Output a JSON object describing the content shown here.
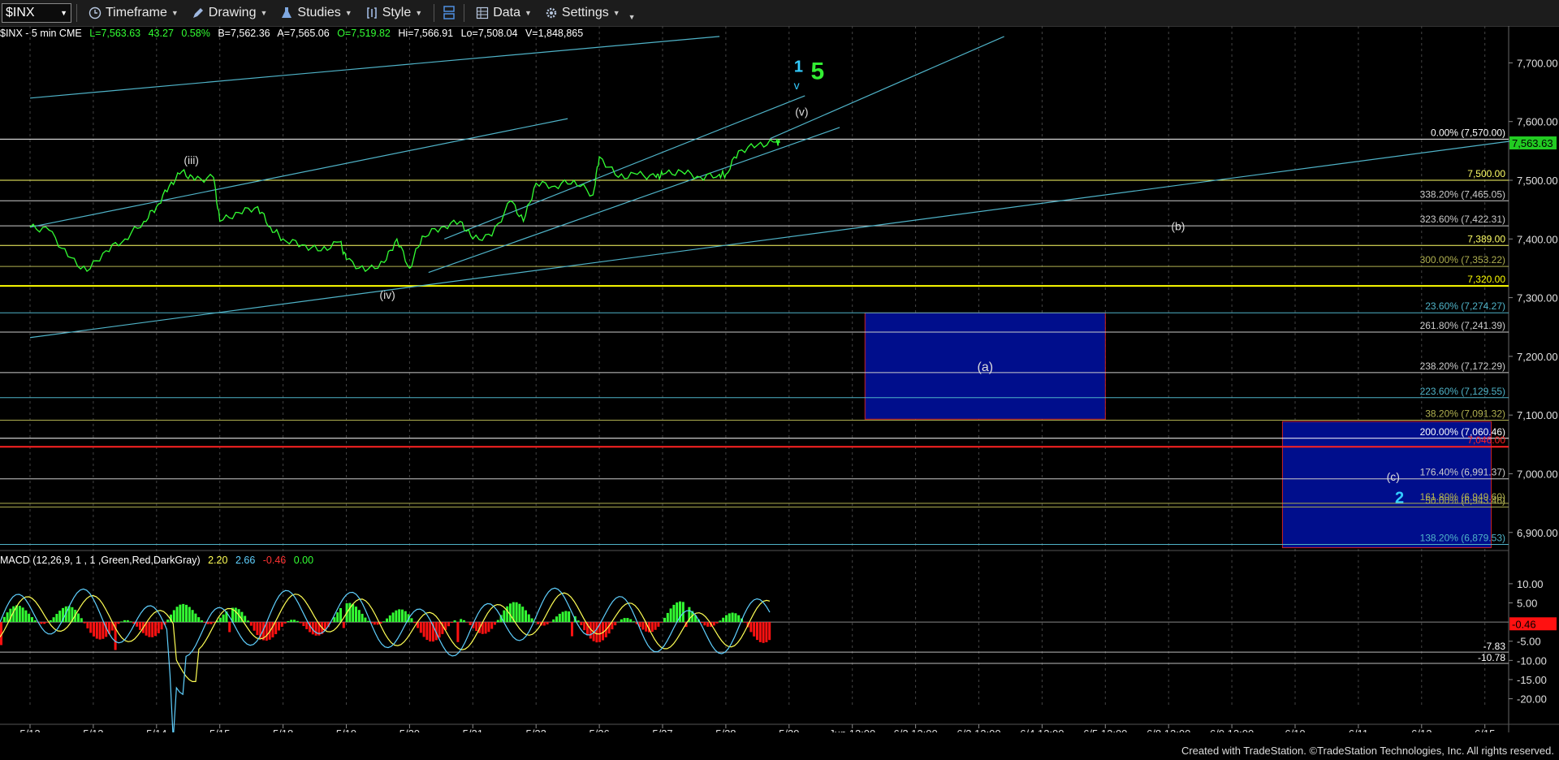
{
  "toolbar": {
    "symbol": "$INX",
    "items": [
      {
        "label": "Timeframe",
        "icon": "clock-icon"
      },
      {
        "label": "Drawing",
        "icon": "pencil-icon"
      },
      {
        "label": "Studies",
        "icon": "flask-icon"
      },
      {
        "label": "Style",
        "icon": "brackets-icon"
      },
      {
        "label": "Data",
        "icon": "grid-icon"
      },
      {
        "label": "Settings",
        "icon": "gear-icon"
      }
    ]
  },
  "info": {
    "symbol": "$INX - 5 min  CME",
    "last": "L=7,563.63",
    "chg": "43.27",
    "pct": "0.58%",
    "bid": "B=7,562.36",
    "ask": "A=7,565.06",
    "open": "O=7,519.82",
    "hi": "Hi=7,566.91",
    "lo": "Lo=7,508.04",
    "vol": "V=1,848,865"
  },
  "macd": {
    "label": "MACD (12,26,9, 1 , 1 ,Green,Red,DarkGray)",
    "v1": "2.20",
    "v2": "2.66",
    "v3": "-0.46",
    "v4": "0.00"
  },
  "footer": "Created with TradeStation. ©TradeStation Technologies, Inc. All rights reserved.",
  "colors": {
    "price": "#33ff33",
    "channel": "#4fb3c8",
    "box": "#000e8c",
    "macd_pos": "#33ff33",
    "macd_neg": "#ff1111"
  },
  "chart_data": {
    "type": "line",
    "title": "$INX - 5 min",
    "x_ticks": [
      "5/12",
      "5/13",
      "5/14",
      "5/15",
      "5/18",
      "5/19",
      "5/20",
      "5/21",
      "5/22",
      "5/26",
      "5/27",
      "5/28",
      "5/29",
      "Jun 12:00",
      "6/2 12:00",
      "6/3 12:00",
      "6/4 12:00",
      "6/5 12:00",
      "6/8 12:00",
      "6/9 12:00",
      "6/10",
      "6/11",
      "6/12",
      "6/15"
    ],
    "y_ticks": [
      "7,700.00",
      "7,600.00",
      "7,500.00",
      "7,400.00",
      "7,300.00",
      "7,200.00",
      "7,100.00",
      "7,000.00",
      "6,900.00"
    ],
    "ylim": [
      6872,
      7749
    ],
    "last_price": "7,563.63",
    "price_series": [
      {
        "x": 0.0,
        "y": 7420
      },
      {
        "x": 0.3,
        "y": 7415
      },
      {
        "x": 0.6,
        "y": 7370
      },
      {
        "x": 0.9,
        "y": 7345
      },
      {
        "x": 1.2,
        "y": 7380
      },
      {
        "x": 1.5,
        "y": 7400
      },
      {
        "x": 1.8,
        "y": 7430
      },
      {
        "x": 2.0,
        "y": 7455
      },
      {
        "x": 2.2,
        "y": 7490
      },
      {
        "x": 2.4,
        "y": 7515
      },
      {
        "x": 2.6,
        "y": 7500
      },
      {
        "x": 2.9,
        "y": 7505
      },
      {
        "x": 3.0,
        "y": 7430
      },
      {
        "x": 3.3,
        "y": 7445
      },
      {
        "x": 3.6,
        "y": 7455
      },
      {
        "x": 3.8,
        "y": 7420
      },
      {
        "x": 4.0,
        "y": 7400
      },
      {
        "x": 4.3,
        "y": 7390
      },
      {
        "x": 4.6,
        "y": 7380
      },
      {
        "x": 4.9,
        "y": 7395
      },
      {
        "x": 5.0,
        "y": 7365
      },
      {
        "x": 5.3,
        "y": 7345
      },
      {
        "x": 5.6,
        "y": 7360
      },
      {
        "x": 5.8,
        "y": 7400
      },
      {
        "x": 6.0,
        "y": 7350
      },
      {
        "x": 6.2,
        "y": 7405
      },
      {
        "x": 6.5,
        "y": 7420
      },
      {
        "x": 6.8,
        "y": 7430
      },
      {
        "x": 7.0,
        "y": 7400
      },
      {
        "x": 7.3,
        "y": 7405
      },
      {
        "x": 7.6,
        "y": 7465
      },
      {
        "x": 7.8,
        "y": 7430
      },
      {
        "x": 8.0,
        "y": 7495
      },
      {
        "x": 8.3,
        "y": 7490
      },
      {
        "x": 8.6,
        "y": 7500
      },
      {
        "x": 8.9,
        "y": 7475
      },
      {
        "x": 9.0,
        "y": 7540
      },
      {
        "x": 9.3,
        "y": 7505
      },
      {
        "x": 9.6,
        "y": 7510
      },
      {
        "x": 9.9,
        "y": 7505
      },
      {
        "x": 10.0,
        "y": 7510
      },
      {
        "x": 10.3,
        "y": 7515
      },
      {
        "x": 10.6,
        "y": 7505
      },
      {
        "x": 10.9,
        "y": 7510
      },
      {
        "x": 11.0,
        "y": 7510
      },
      {
        "x": 11.2,
        "y": 7550
      },
      {
        "x": 11.5,
        "y": 7560
      },
      {
        "x": 11.8,
        "y": 7565
      },
      {
        "x": 11.85,
        "y": 7563.63
      }
    ],
    "horizontal_levels": [
      {
        "label": "0.00% (7,570.00)",
        "value": 7570.0,
        "color": "#ffffff"
      },
      {
        "label": "7,500.00",
        "value": 7500.0,
        "color": "#ffff66"
      },
      {
        "label": "338.20% (7,465.05)",
        "value": 7465.05,
        "color": "#cccccc"
      },
      {
        "label": "323.60% (7,422.31)",
        "value": 7422.31,
        "color": "#cccccc"
      },
      {
        "label": "7,389.00",
        "value": 7389.0,
        "color": "#ffff66"
      },
      {
        "label": "300.00% (7,353.22)",
        "value": 7353.22,
        "color": "#b0b050"
      },
      {
        "label": "7,320.00",
        "value": 7320.0,
        "color": "#ffff00"
      },
      {
        "label": "23.60% (7,274.27)",
        "value": 7274.27,
        "color": "#4fb3c8"
      },
      {
        "label": "261.80% (7,241.39)",
        "value": 7241.39,
        "color": "#cccccc"
      },
      {
        "label": "238.20% (7,172.29)",
        "value": 7172.29,
        "color": "#cccccc"
      },
      {
        "label": "223.60% (7,129.55)",
        "value": 7129.55,
        "color": "#4fb3c8"
      },
      {
        "label": "38.20% (7,091.32)",
        "value": 7091.32,
        "color": "#b0b050"
      },
      {
        "label": "200.00% (7,060.46)",
        "value": 7060.46,
        "color": "#ffffff"
      },
      {
        "label": "7,046.00",
        "value": 7046.0,
        "color": "#ff2222"
      },
      {
        "label": "176.40% (6,991.37)",
        "value": 6991.37,
        "color": "#cccccc"
      },
      {
        "label": "161.80% (6,949.60)",
        "value": 6949.6,
        "color": "#b0b050"
      },
      {
        "label": "50.00% (6,943.46)",
        "value": 6943.46,
        "color": "#b0b050"
      },
      {
        "label": "138.20% (6,879.53)",
        "value": 6879.53,
        "color": "#4fb3c8"
      }
    ],
    "boxes": [
      {
        "label": "(a)",
        "x0": 13.2,
        "x1": 17.0,
        "y0": 7093,
        "y1": 7274
      },
      {
        "label": "(c)",
        "x0": 19.8,
        "x1": 23.1,
        "y0": 6874,
        "y1": 7089
      }
    ],
    "wave_labels": [
      {
        "text": "(iii)",
        "x": 2.55,
        "y": 7528,
        "color": "#dddddd"
      },
      {
        "text": "(iv)",
        "x": 5.65,
        "y": 7298,
        "color": "#dddddd"
      },
      {
        "text": "(v)",
        "x": 12.2,
        "y": 7610,
        "color": "#dddddd"
      },
      {
        "text": "1",
        "x": 12.15,
        "y": 7685,
        "color": "#33ccff"
      },
      {
        "text": "v",
        "x": 12.12,
        "y": 7655,
        "color": "#33ccff"
      },
      {
        "text": "5",
        "x": 12.45,
        "y": 7672,
        "color": "#33ee33"
      },
      {
        "text": "(b)",
        "x": 18.15,
        "y": 7415,
        "color": "#dddddd"
      },
      {
        "text": "(c)",
        "x": 21.55,
        "y": 6988,
        "color": "#dddddd"
      },
      {
        "text": "2",
        "x": 21.65,
        "y": 6950,
        "color": "#33ccff"
      }
    ],
    "macd_yticks": [
      "10.00",
      "5.00",
      "-5.00",
      "-10.00",
      "-15.00",
      "-20.00"
    ],
    "macd_ylim": [
      -22,
      14
    ],
    "macd_levels": [
      {
        "label": "-7.83",
        "value": -7.83
      },
      {
        "label": "-10.78",
        "value": -10.78
      }
    ],
    "macd_last": "-0.46"
  }
}
